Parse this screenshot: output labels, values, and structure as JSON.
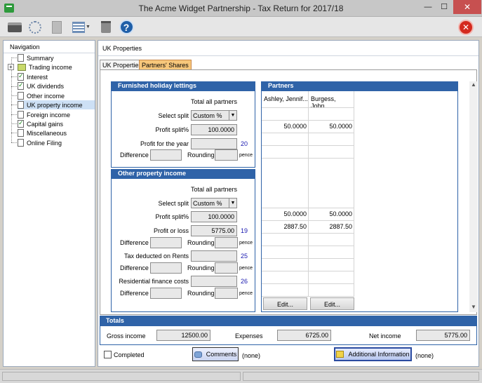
{
  "window": {
    "title": "The Acme Widget Partnership - Tax Return for 2017/18",
    "minimize": "—",
    "maximize": "☐",
    "close": "✕"
  },
  "toolbar": {
    "icons": [
      "printer-icon",
      "antenna-icon",
      "document-icon",
      "list-icon",
      "bin-icon",
      "help-icon",
      "exit-icon"
    ],
    "help_glyph": "?",
    "exit_glyph": "✕"
  },
  "navigation": {
    "header": "Navigation",
    "items": [
      {
        "label": "Summary"
      },
      {
        "label": "Trading income"
      },
      {
        "label": "Interest"
      },
      {
        "label": "UK dividends"
      },
      {
        "label": "Other income"
      },
      {
        "label": "UK property income"
      },
      {
        "label": "Foreign income"
      },
      {
        "label": "Capital gains"
      },
      {
        "label": "Miscellaneous"
      },
      {
        "label": "Online Filing"
      }
    ],
    "expander": "+"
  },
  "main": {
    "header": "UK Properties",
    "tabs": [
      {
        "label": "UK Properties"
      },
      {
        "label": "Partners' Shares"
      }
    ]
  },
  "fhl": {
    "title": "Furnished holiday lettings",
    "total_all_partners": "Total all partners",
    "select_split_label": "Select split",
    "select_split_value": "Custom %",
    "profit_split_label": "Profit split%",
    "profit_split_value": "100.0000",
    "profit_year_label": "Profit for the year",
    "profit_year_value": "",
    "profit_year_ref": "20",
    "difference_label": "Difference",
    "rounding_label": "Rounding",
    "pence": "pence"
  },
  "opi": {
    "title": "Other property income",
    "total_all_partners": "Total all partners",
    "select_split_label": "Select split",
    "select_split_value": "Custom %",
    "profit_split_label": "Profit split%",
    "profit_split_value": "100.0000",
    "profit_loss_label": "Profit or loss",
    "profit_loss_value": "5775.00",
    "profit_loss_ref": "19",
    "tax_rents_label": "Tax deducted on Rents",
    "tax_rents_ref": "25",
    "res_finance_label": "Residential finance costs",
    "res_finance_ref": "26",
    "difference_label": "Difference",
    "rounding_label": "Rounding",
    "pence": "pence"
  },
  "partners": {
    "title": "Partners",
    "names": [
      "Ashley, Jennif...",
      "Burgess, John..."
    ],
    "fhl_split": [
      "50.0000",
      "50.0000"
    ],
    "opi_split": [
      "50.0000",
      "50.0000"
    ],
    "opi_profit": [
      "2887.50",
      "2887.50"
    ],
    "edit_label": "Edit...",
    "scroll_up": "▲",
    "scroll_down": "▼"
  },
  "totals": {
    "title": "Totals",
    "gross_label": "Gross income",
    "gross_value": "12500.00",
    "expenses_label": "Expenses",
    "expenses_value": "6725.00",
    "net_label": "Net income",
    "net_value": "5775.00"
  },
  "bottom": {
    "completed_label": "Completed",
    "comments_label": "Comments",
    "comments_status": "(none)",
    "additional_label": "Additional Information",
    "additional_status": "(none)"
  }
}
